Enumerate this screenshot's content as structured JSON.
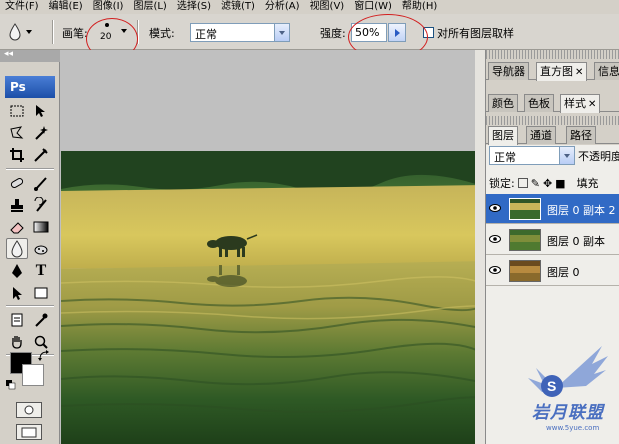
{
  "menu": [
    "文件(F)",
    "编辑(E)",
    "图像(I)",
    "图层(L)",
    "选择(S)",
    "滤镜(T)",
    "分析(A)",
    "视图(V)",
    "窗口(W)",
    "帮助(H)"
  ],
  "options": {
    "brush_label": "画笔:",
    "brush_size": "20",
    "mode_label": "模式:",
    "mode_value": "正常",
    "strength_label": "强度:",
    "strength_value": "50%",
    "sample_all_label": "对所有图层取样"
  },
  "toolbox": {
    "collapse": "◂◂",
    "logo": "Ps"
  },
  "panels": {
    "group1_tabs": [
      "导航器",
      "直方图",
      "信息"
    ],
    "group2_tabs": [
      "颜色",
      "色板",
      "样式"
    ],
    "group3_tabs": [
      "图层",
      "通道",
      "路径"
    ],
    "blend_mode": "正常",
    "opacity_label": "不透明度",
    "lock_label": "锁定:",
    "fill_label": "填充",
    "layers": [
      {
        "name": "图层 0 副本 2",
        "selected": true
      },
      {
        "name": "图层 0 副本",
        "selected": false
      },
      {
        "name": "图层 0",
        "selected": false
      }
    ]
  },
  "watermark": {
    "text": "岩月联盟",
    "url": "www.5yue.com"
  },
  "colors": {
    "selection_blue": "#316ac5",
    "annotation_red": "#d21e1e",
    "ps_blue": "#1c4fa8"
  }
}
